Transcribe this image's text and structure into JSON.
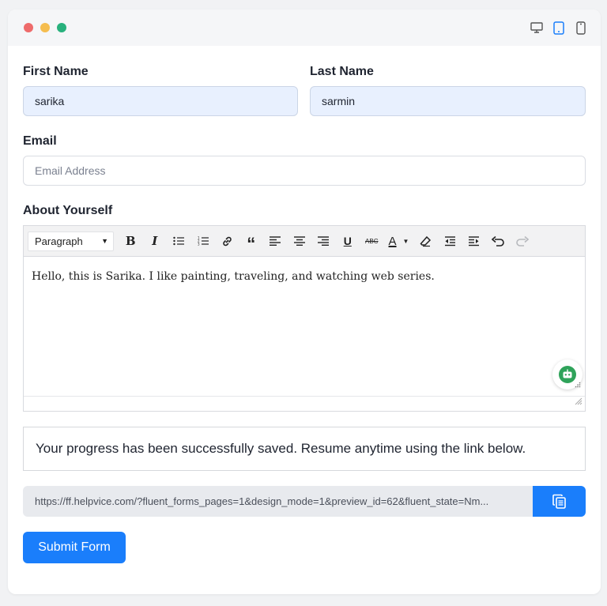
{
  "window": {
    "traffic_lights": [
      "#ee6b6b",
      "#f5bd4f",
      "#28b17d"
    ],
    "device_icons": [
      "desktop-icon",
      "tablet-icon",
      "mobile-icon"
    ],
    "active_device": "tablet-icon"
  },
  "form": {
    "first_name": {
      "label": "First Name",
      "value": "sarika"
    },
    "last_name": {
      "label": "Last Name",
      "value": "sarmin"
    },
    "email": {
      "label": "Email",
      "placeholder": "Email Address"
    },
    "about": {
      "label": "About Yourself",
      "format_select": "Paragraph",
      "toolbar_icons": [
        "bold-icon",
        "italic-icon",
        "bullet-list-icon",
        "numbered-list-icon",
        "link-icon",
        "blockquote-icon",
        "align-left-icon",
        "align-center-icon",
        "align-right-icon",
        "underline-icon",
        "strikethrough-icon",
        "text-color-icon",
        "clear-format-icon",
        "outdent-icon",
        "indent-icon",
        "undo-icon",
        "redo-icon"
      ],
      "content": "Hello, this is Sarika. I like painting, traveling, and watching web series."
    },
    "notice": "Your progress has been successfully saved. Resume anytime using the link below.",
    "resume_link": "https://ff.helpvice.com/?fluent_forms_pages=1&design_mode=1&preview_id=62&fluent_state=Nm...",
    "submit_label": "Submit Form"
  },
  "colors": {
    "accent": "#1a7efb",
    "filled_input": "#e8f0fe"
  }
}
